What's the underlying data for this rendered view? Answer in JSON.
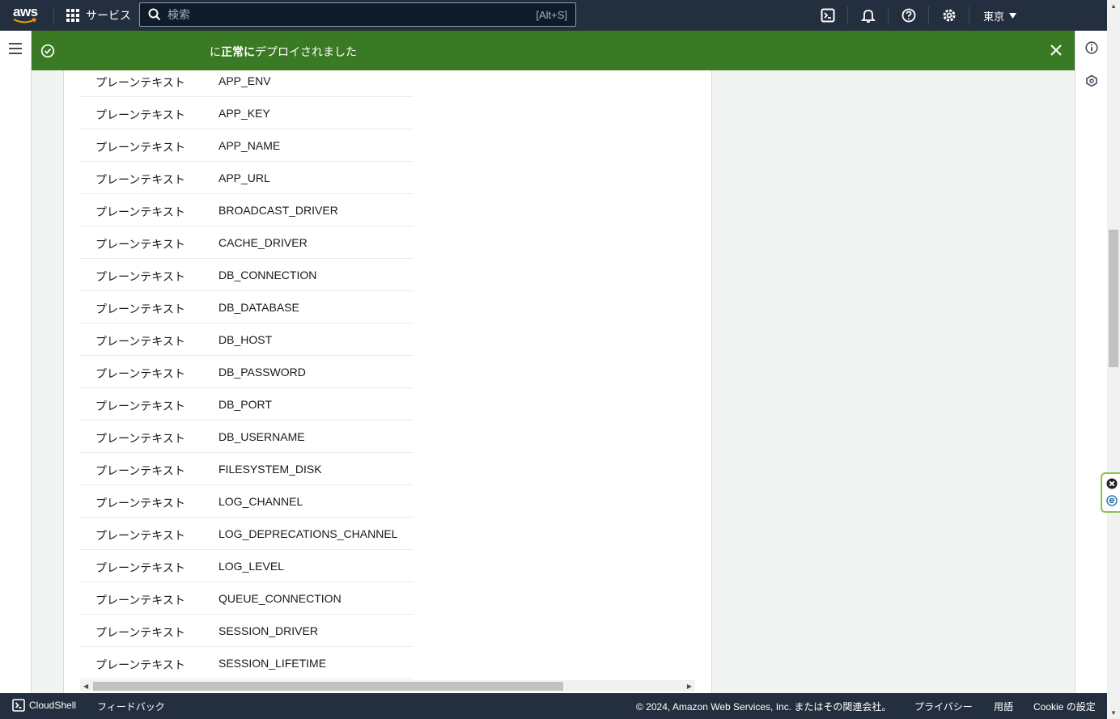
{
  "topnav": {
    "logo": "aws",
    "services_label": "サービス",
    "search_placeholder": "検索",
    "search_shortcut": "[Alt+S]",
    "region_label": "東京"
  },
  "flash": {
    "message_bold": "正常に",
    "message_prefix": "に",
    "message_suffix": "デプロイされました",
    "status_color": "#3b7a24"
  },
  "env_table": {
    "rows": [
      {
        "type": "プレーンテキスト",
        "name": "APP_ENV"
      },
      {
        "type": "プレーンテキスト",
        "name": "APP_KEY"
      },
      {
        "type": "プレーンテキスト",
        "name": "APP_NAME"
      },
      {
        "type": "プレーンテキスト",
        "name": "APP_URL"
      },
      {
        "type": "プレーンテキスト",
        "name": "BROADCAST_DRIVER"
      },
      {
        "type": "プレーンテキスト",
        "name": "CACHE_DRIVER"
      },
      {
        "type": "プレーンテキスト",
        "name": "DB_CONNECTION"
      },
      {
        "type": "プレーンテキスト",
        "name": "DB_DATABASE"
      },
      {
        "type": "プレーンテキスト",
        "name": "DB_HOST"
      },
      {
        "type": "プレーンテキスト",
        "name": "DB_PASSWORD"
      },
      {
        "type": "プレーンテキスト",
        "name": "DB_PORT"
      },
      {
        "type": "プレーンテキスト",
        "name": "DB_USERNAME"
      },
      {
        "type": "プレーンテキスト",
        "name": "FILESYSTEM_DISK"
      },
      {
        "type": "プレーンテキスト",
        "name": "LOG_CHANNEL"
      },
      {
        "type": "プレーンテキスト",
        "name": "LOG_DEPRECATIONS_CHANNEL"
      },
      {
        "type": "プレーンテキスト",
        "name": "LOG_LEVEL"
      },
      {
        "type": "プレーンテキスト",
        "name": "QUEUE_CONNECTION"
      },
      {
        "type": "プレーンテキスト",
        "name": "SESSION_DRIVER"
      },
      {
        "type": "プレーンテキスト",
        "name": "SESSION_LIFETIME"
      }
    ]
  },
  "footer": {
    "cloudshell": "CloudShell",
    "feedback": "フィードバック",
    "copyright": "© 2024, Amazon Web Services, Inc. またはその関連会社。",
    "privacy": "プライバシー",
    "terms": "用語",
    "cookie": "Cookie の設定"
  }
}
